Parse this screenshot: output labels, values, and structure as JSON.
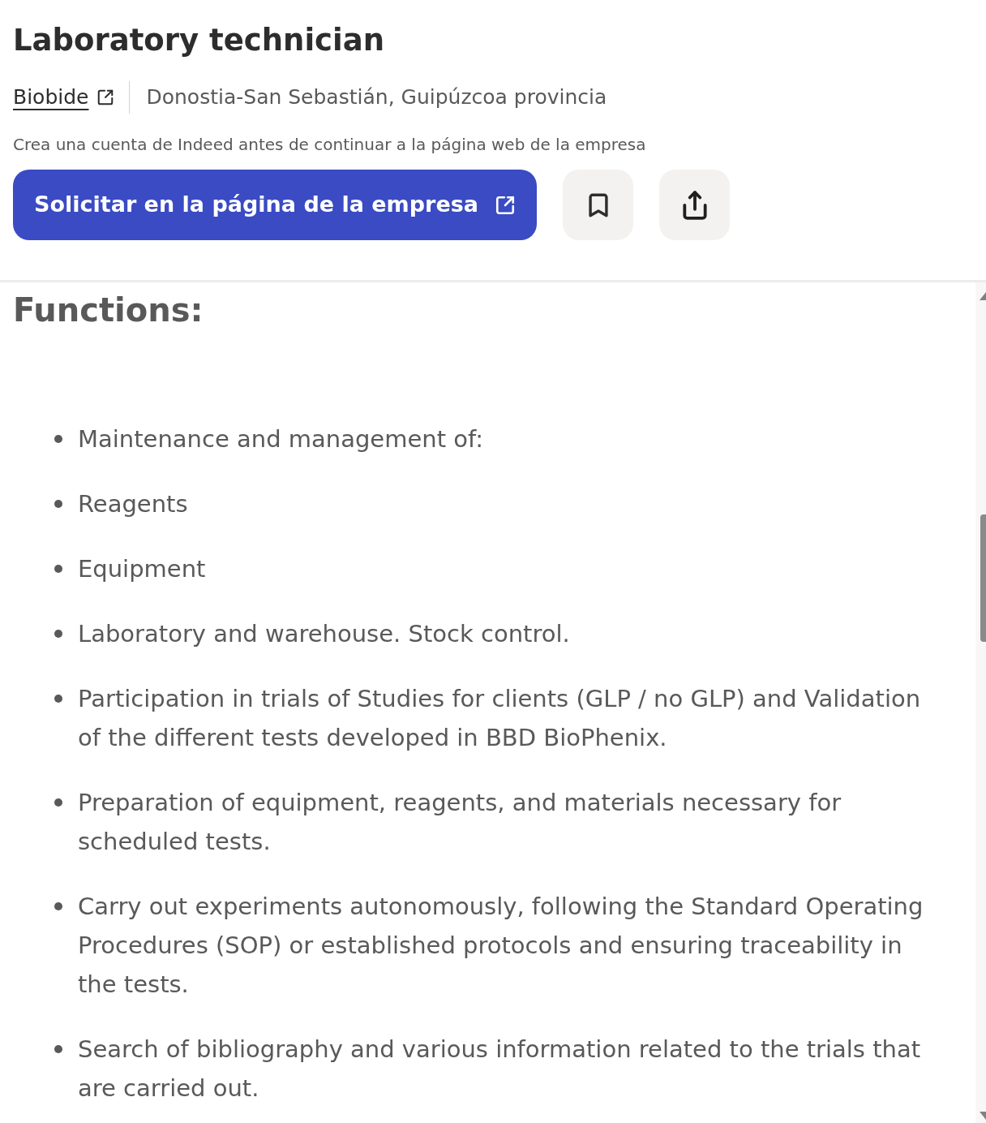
{
  "job": {
    "title": "Laboratory technician",
    "company": "Biobide",
    "location": "Donostia-San Sebastián, Guipúzcoa provincia",
    "note": "Crea una cuenta de Indeed antes de continuar a la página web de la empresa",
    "apply_button": "Solicitar en la página de la empresa"
  },
  "description": {
    "heading": "Functions:",
    "items": [
      "Maintenance and management of:",
      "Reagents",
      "Equipment",
      "Laboratory and warehouse. Stock control.",
      "Participation in trials of Studies for clients (GLP / no GLP) and Validation of the different tests developed in BBD BioPhenix.",
      "Preparation of equipment, reagents, and materials necessary for scheduled tests.",
      "Carry out experiments autonomously, following the Standard Operating Procedures (SOP) or established protocols and ensuring traceability in the tests.",
      "Search of bibliography and various information related to the trials that are carried out."
    ]
  }
}
